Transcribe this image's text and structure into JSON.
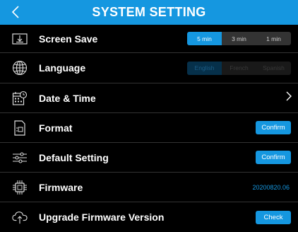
{
  "header": {
    "title": "SYSTEM SETTING"
  },
  "rows": {
    "screen_save": {
      "label": "Screen Save",
      "options": [
        "5 min",
        "3 min",
        "1 min"
      ],
      "selected": "5 min"
    },
    "language": {
      "label": "Language",
      "options": [
        "English",
        "French",
        "Spanish"
      ],
      "selected": "English"
    },
    "date_time": {
      "label": "Date & Time"
    },
    "format": {
      "label": "Format",
      "button": "Confirm"
    },
    "default_setting": {
      "label": "Default Setting",
      "button": "Confirm"
    },
    "firmware": {
      "label": "Firmware",
      "value": "20200820.06"
    },
    "upgrade": {
      "label": "Upgrade Firmware Version",
      "button": "Check"
    }
  },
  "colors": {
    "accent": "#1597e0",
    "background": "#000000",
    "divider": "#333333"
  },
  "icons": [
    "back-chevron-icon",
    "download-icon",
    "globe-icon",
    "calendar-clock-icon",
    "file-icon",
    "sliders-icon",
    "chip-icon",
    "cloud-upload-icon",
    "chevron-right-icon"
  ]
}
